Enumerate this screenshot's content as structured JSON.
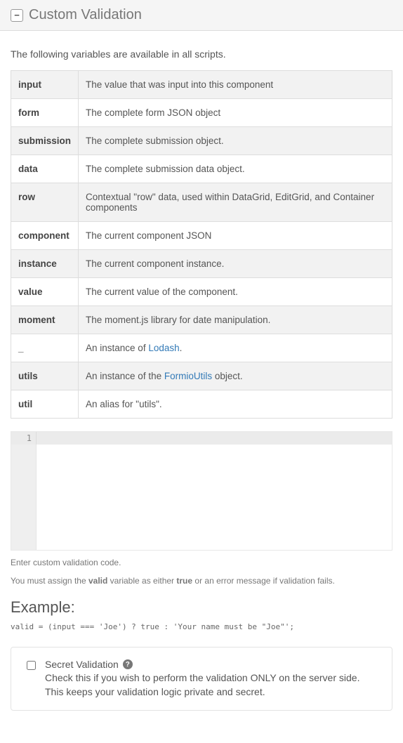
{
  "header": {
    "collapse_glyph": "−",
    "title": "Custom Validation"
  },
  "intro": "The following variables are available in all scripts.",
  "vars": [
    {
      "name": "input",
      "desc": "The value that was input into this component"
    },
    {
      "name": "form",
      "desc": "The complete form JSON object"
    },
    {
      "name": "submission",
      "desc": "The complete submission object."
    },
    {
      "name": "data",
      "desc": "The complete submission data object."
    },
    {
      "name": "row",
      "desc": "Contextual \"row\" data, used within DataGrid, EditGrid, and Container components"
    },
    {
      "name": "component",
      "desc": "The current component JSON"
    },
    {
      "name": "instance",
      "desc": "The current component instance."
    },
    {
      "name": "value",
      "desc": "The current value of the component."
    },
    {
      "name": "moment",
      "desc": "The moment.js library for date manipulation."
    },
    {
      "name": "_",
      "desc_pre": "An instance of ",
      "link": "Lodash",
      "desc_post": "."
    },
    {
      "name": "utils",
      "desc_pre": "An instance of the ",
      "link": "FormioUtils",
      "desc_post": " object."
    },
    {
      "name": "util",
      "desc": "An alias for \"utils\"."
    }
  ],
  "editor": {
    "line_no": "1",
    "value": ""
  },
  "hints": {
    "enter": "Enter custom validation code.",
    "assign_pre": "You must assign the ",
    "assign_b1": "valid",
    "assign_mid": " variable as either ",
    "assign_b2": "true",
    "assign_post": " or an error message if validation fails."
  },
  "example": {
    "heading": "Example:",
    "code": "valid = (input === 'Joe') ? true : 'Your name must be \"Joe\"';"
  },
  "secret": {
    "title": "Secret Validation",
    "help_glyph": "?",
    "desc": "Check this if you wish to perform the validation ONLY on the server side. This keeps your validation logic private and secret."
  }
}
